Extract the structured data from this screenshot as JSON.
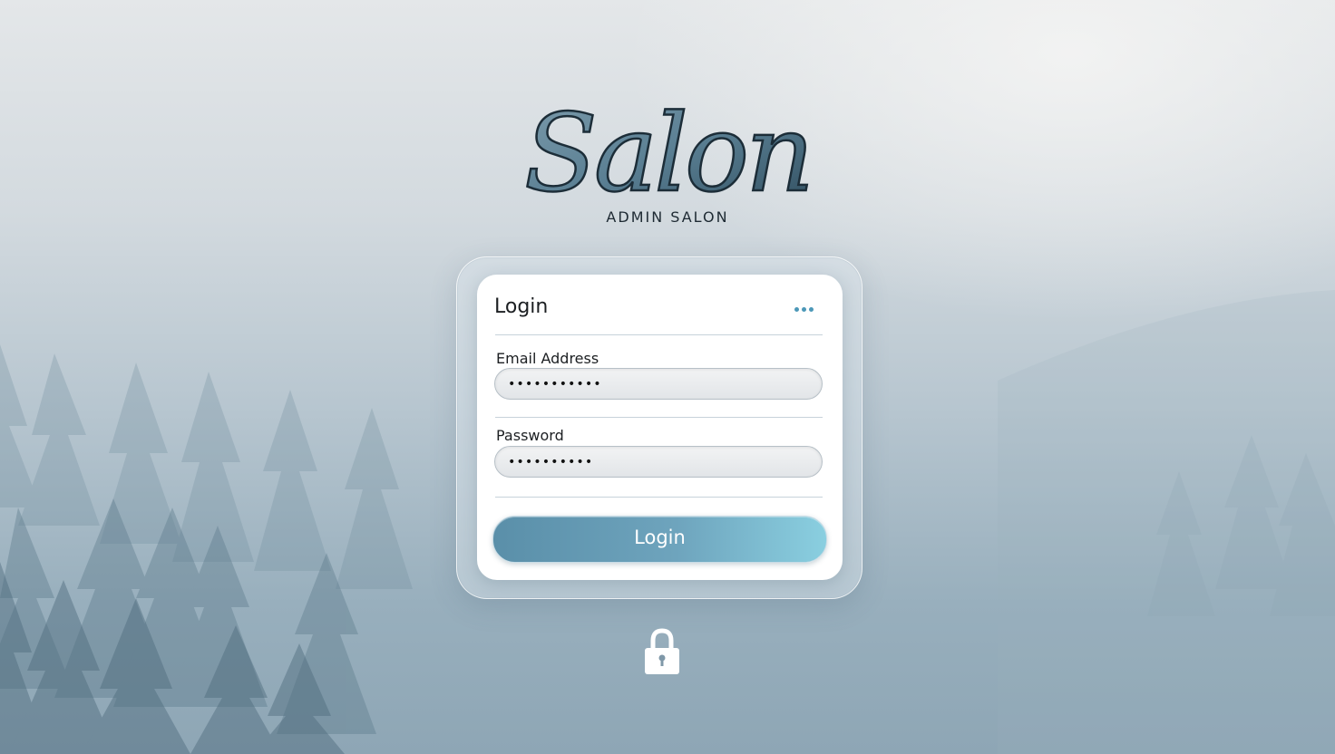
{
  "brand": {
    "logo_text": "Salon",
    "subtitle": "ADMIN SALON"
  },
  "login_card": {
    "title": "Login",
    "menu_icon": "more-horizontal-icon",
    "email": {
      "label": "Email Address",
      "value": "•••••••••••"
    },
    "password": {
      "label": "Password",
      "value": "••••••••••"
    },
    "submit_label": "Login"
  },
  "footer_icon": "lock-icon",
  "colors": {
    "accent": "#4c98b8",
    "button_start": "#5a8fa9",
    "button_end": "#8acfe0",
    "text_dark": "#1c1f22"
  }
}
